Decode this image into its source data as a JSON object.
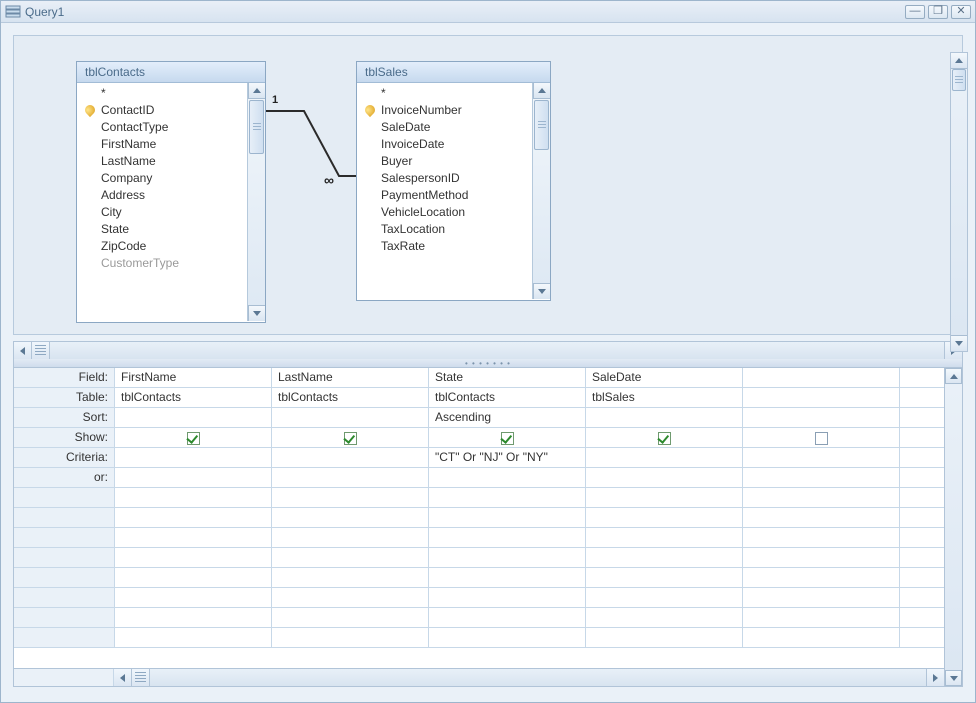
{
  "window": {
    "title": "Query1"
  },
  "tables": {
    "contacts": {
      "name": "tblContacts",
      "fields": [
        "*",
        "ContactID",
        "ContactType",
        "FirstName",
        "LastName",
        "Company",
        "Address",
        "City",
        "State",
        "ZipCode",
        "CustomerType"
      ],
      "pkIndex": 1
    },
    "sales": {
      "name": "tblSales",
      "fields": [
        "*",
        "InvoiceNumber",
        "SaleDate",
        "InvoiceDate",
        "Buyer",
        "SalespersonID",
        "PaymentMethod",
        "VehicleLocation",
        "TaxLocation",
        "TaxRate"
      ],
      "pkIndex": 1
    }
  },
  "relationship": {
    "leftLabel": "1",
    "rightLabel": "∞"
  },
  "gridLabels": {
    "field": "Field:",
    "table": "Table:",
    "sort": "Sort:",
    "show": "Show:",
    "criteria": "Criteria:",
    "or": "or:"
  },
  "grid": {
    "columns": [
      {
        "field": "FirstName",
        "table": "tblContacts",
        "sort": "",
        "show": true,
        "criteria": "",
        "or": ""
      },
      {
        "field": "LastName",
        "table": "tblContacts",
        "sort": "",
        "show": true,
        "criteria": "",
        "or": ""
      },
      {
        "field": "State",
        "table": "tblContacts",
        "sort": "Ascending",
        "show": true,
        "criteria": "\"CT\" Or \"NJ\" Or \"NY\"",
        "or": ""
      },
      {
        "field": "SaleDate",
        "table": "tblSales",
        "sort": "",
        "show": true,
        "criteria": "",
        "or": ""
      },
      {
        "field": "",
        "table": "",
        "sort": "",
        "show": false,
        "criteria": "",
        "or": ""
      },
      {
        "field": "",
        "table": "",
        "sort": "",
        "show": null,
        "criteria": "",
        "or": ""
      }
    ]
  }
}
